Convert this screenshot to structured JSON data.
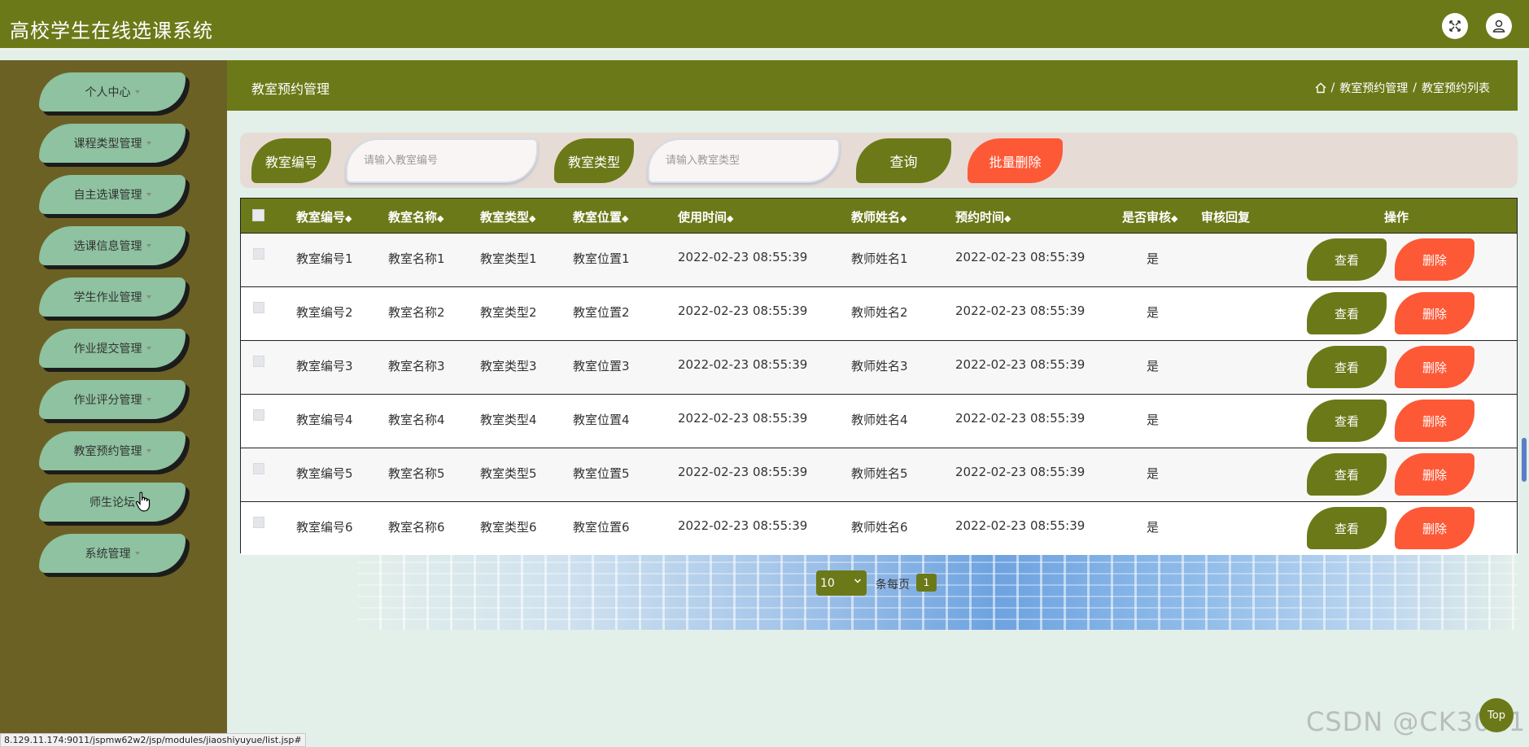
{
  "header": {
    "title": "高校学生在线选课系统",
    "fullscreen_icon": "fullscreen-icon",
    "user_icon": "user-icon"
  },
  "sidebar": {
    "items": [
      {
        "label": "个人中心",
        "has_caret": true
      },
      {
        "label": "课程类型管理",
        "has_caret": true
      },
      {
        "label": "自主选课管理",
        "has_caret": true
      },
      {
        "label": "选课信息管理",
        "has_caret": true
      },
      {
        "label": "学生作业管理",
        "has_caret": true
      },
      {
        "label": "作业提交管理",
        "has_caret": true
      },
      {
        "label": "作业评分管理",
        "has_caret": true
      },
      {
        "label": "教室预约管理",
        "has_caret": true
      },
      {
        "label": "师生论坛",
        "has_caret": false
      },
      {
        "label": "系统管理",
        "has_caret": true
      }
    ]
  },
  "page": {
    "title": "教室预约管理",
    "breadcrumb": {
      "sep": "/",
      "level1": "教室预约管理",
      "level2": "教室预约列表"
    }
  },
  "search": {
    "field1_label": "教室编号",
    "field1_placeholder": "请输入教室编号",
    "field2_label": "教室类型",
    "field2_placeholder": "请输入教室类型",
    "query_label": "查询",
    "batch_delete_label": "批量删除"
  },
  "table": {
    "columns": [
      "教室编号",
      "教室名称",
      "教室类型",
      "教室位置",
      "使用时间",
      "教师姓名",
      "预约时间",
      "是否审核",
      "审核回复",
      "操作"
    ],
    "sort_glyph": "◆",
    "rows": [
      [
        "教室编号1",
        "教室名称1",
        "教室类型1",
        "教室位置1",
        "2022-02-23 08:55:39",
        "教师姓名1",
        "2022-02-23 08:55:39",
        "是",
        ""
      ],
      [
        "教室编号2",
        "教室名称2",
        "教室类型2",
        "教室位置2",
        "2022-02-23 08:55:39",
        "教师姓名2",
        "2022-02-23 08:55:39",
        "是",
        ""
      ],
      [
        "教室编号3",
        "教室名称3",
        "教室类型3",
        "教室位置3",
        "2022-02-23 08:55:39",
        "教师姓名3",
        "2022-02-23 08:55:39",
        "是",
        ""
      ],
      [
        "教室编号4",
        "教室名称4",
        "教室类型4",
        "教室位置4",
        "2022-02-23 08:55:39",
        "教师姓名4",
        "2022-02-23 08:55:39",
        "是",
        ""
      ],
      [
        "教室编号5",
        "教室名称5",
        "教室类型5",
        "教室位置5",
        "2022-02-23 08:55:39",
        "教师姓名5",
        "2022-02-23 08:55:39",
        "是",
        ""
      ],
      [
        "教室编号6",
        "教室名称6",
        "教室类型6",
        "教室位置6",
        "2022-02-23 08:55:39",
        "教师姓名6",
        "2022-02-23 08:55:39",
        "是",
        ""
      ]
    ],
    "view_label": "查看",
    "delete_label": "删除"
  },
  "pagination": {
    "page_size": "10",
    "per_page_label": "条每页",
    "current_page": "1"
  },
  "status_bar": {
    "url": "8.129.11.174:9011/jspmw62w2/jsp/modules/jiaoshiyuyue/list.jsp#"
  },
  "watermark": "CSDN @CK3011",
  "top_button": "Top",
  "colors": {
    "primary": "#6c7918",
    "danger": "#fd5937",
    "sidebar_bg": "#6c6124",
    "menu_item": "#8ec2a0",
    "page_bg": "#e3efe9"
  }
}
